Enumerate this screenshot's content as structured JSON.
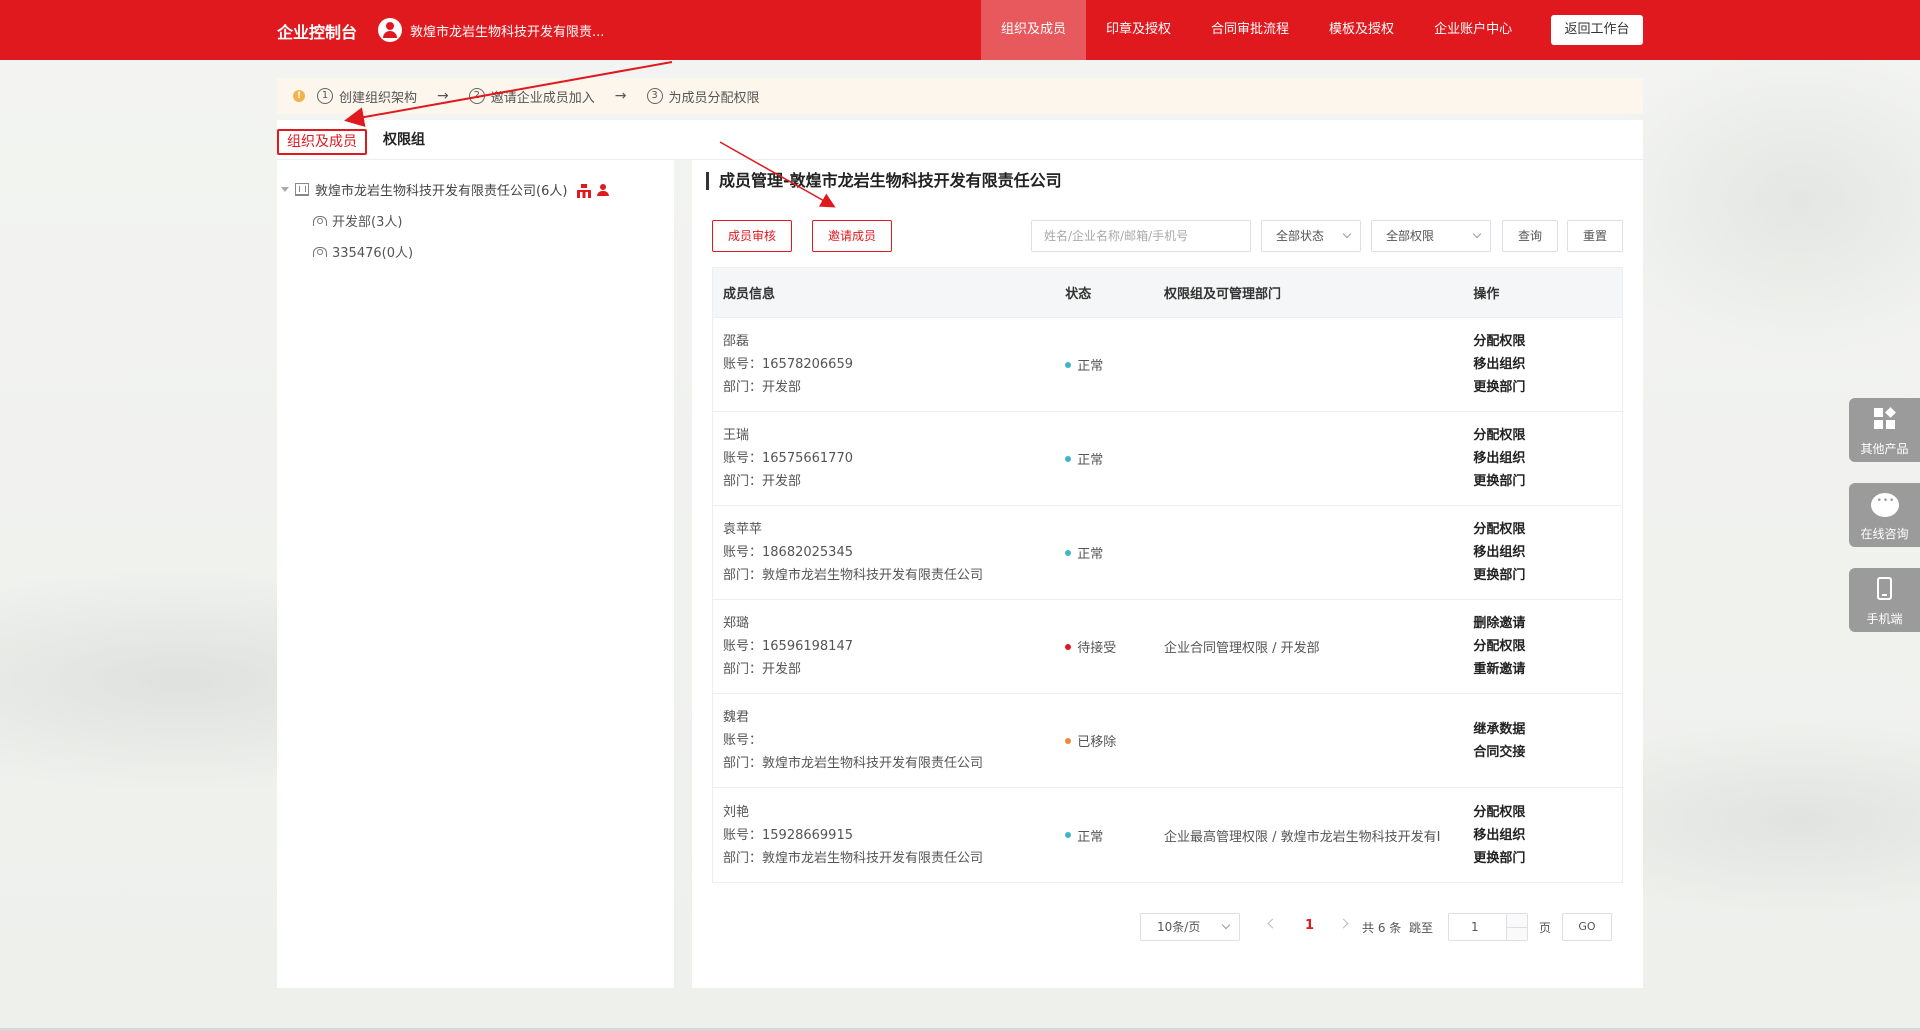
{
  "header": {
    "brand": "企业控制台",
    "company": "敦煌市龙岩生物科技开发有限责...",
    "nav": [
      "组织及成员",
      "印章及授权",
      "合同审批流程",
      "模板及授权",
      "企业账户中心"
    ],
    "back_label": "返回工作台"
  },
  "steps": {
    "items": [
      {
        "num": "1",
        "label": "创建组织架构"
      },
      {
        "num": "2",
        "label": "邀请企业成员加入"
      },
      {
        "num": "3",
        "label": "为成员分配权限"
      }
    ]
  },
  "tabs": [
    "组织及成员",
    "权限组"
  ],
  "tree": {
    "root": "敦煌市龙岩生物科技开发有限责任公司(6人)",
    "children": [
      "开发部(3人)",
      "335476(0人)"
    ]
  },
  "panel": {
    "title": "成员管理-敦煌市龙岩生物科技开发有限责任公司",
    "audit_btn": "成员审核",
    "invite_btn": "邀请成员",
    "search_placeholder": "姓名/企业名称/邮箱/手机号",
    "status_select": "全部状态",
    "perm_select": "全部权限",
    "query_btn": "查询",
    "reset_btn": "重置"
  },
  "table": {
    "headers": [
      "成员信息",
      "状态",
      "权限组及可管理部门",
      "操作"
    ],
    "account_label": "账号：",
    "dept_label": "部门：",
    "rows": [
      {
        "name": "邵磊",
        "account": "16578206659",
        "dept": "开发部",
        "status": "正常",
        "perms": "",
        "ops": [
          "分配权限",
          "移出组织",
          "更换部门"
        ]
      },
      {
        "name": "王瑞",
        "account": "16575661770",
        "dept": "开发部",
        "status": "正常",
        "perms": "",
        "ops": [
          "分配权限",
          "移出组织",
          "更换部门"
        ]
      },
      {
        "name": "袁苹苹",
        "account": "18682025345",
        "dept": "敦煌市龙岩生物科技开发有限责任公司",
        "status": "正常",
        "perms": "",
        "ops": [
          "分配权限",
          "移出组织",
          "更换部门"
        ]
      },
      {
        "name": "郑璐",
        "account": "16596198147",
        "dept": "开发部",
        "status": "待接受",
        "perms": "企业合同管理权限 / 开发部",
        "ops": [
          "删除邀请",
          "分配权限",
          "重新邀请"
        ]
      },
      {
        "name": "魏君",
        "account": "",
        "dept": "敦煌市龙岩生物科技开发有限责任公司",
        "status": "已移除",
        "perms": "",
        "ops": [
          "继承数据",
          "合同交接"
        ]
      },
      {
        "name": "刘艳",
        "account": "15928669915",
        "dept": "敦煌市龙岩生物科技开发有限责任公司",
        "status": "正常",
        "perms": "企业最高管理权限 / 敦煌市龙岩生物科技开发有I",
        "ops": [
          "分配权限",
          "移出组织",
          "更换部门"
        ]
      }
    ]
  },
  "status_colors": {
    "正常": "#3fb6c6",
    "待接受": "#e0191f",
    "已移除": "#f0883a"
  },
  "pagination": {
    "page_size": "10条/页",
    "current": "1",
    "total": "共 6 条",
    "jump_label": "跳至",
    "jump_value": "1",
    "page_unit": "页",
    "go": "GO"
  },
  "float": {
    "items": [
      {
        "label": "其他产品",
        "icon": "grid-icon"
      },
      {
        "label": "在线咨询",
        "icon": "chat-icon"
      },
      {
        "label": "手机端",
        "icon": "phone-icon"
      }
    ]
  },
  "colors": {
    "brand": "#e0191f"
  }
}
